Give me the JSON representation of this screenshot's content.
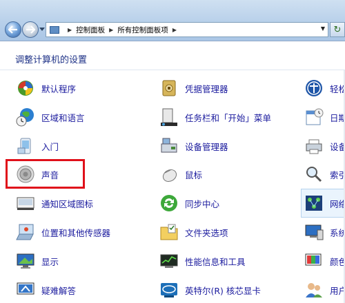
{
  "address_bar": {
    "breadcrumb": [
      "控制面板",
      "所有控制面板项"
    ]
  },
  "page": {
    "title": "调整计算机的设置"
  },
  "items": {
    "col1": [
      "默认程序",
      "区域和语言",
      "入门",
      "声音",
      "通知区域图标",
      "位置和其他传感器",
      "显示",
      "疑难解答"
    ],
    "col2": [
      "凭据管理器",
      "任务栏和「开始」菜单",
      "设备管理器",
      "鼠标",
      "同步中心",
      "文件夹选项",
      "性能信息和工具",
      "英特尔(R) 核芯显卡"
    ],
    "col3": [
      "轻松",
      "日期",
      "设备",
      "索引",
      "网络",
      "系统",
      "颜色",
      "用户"
    ]
  },
  "icons": {
    "col1": [
      "default-programs-icon",
      "globe-clock-icon",
      "getting-started-icon",
      "speaker-icon",
      "notification-area-icon",
      "sensor-icon",
      "monitor-icon",
      "troubleshoot-icon"
    ],
    "col2": [
      "credential-vault-icon",
      "taskbar-icon",
      "device-manager-icon",
      "mouse-icon",
      "sync-center-icon",
      "folder-options-icon",
      "performance-icon",
      "intel-graphics-icon"
    ],
    "col3": [
      "ease-of-access-icon",
      "calendar-icon",
      "devices-printers-icon",
      "indexing-icon",
      "network-icon",
      "system-icon",
      "color-management-icon",
      "user-accounts-icon"
    ]
  },
  "colors": {
    "link": "#1b1b9e",
    "title": "#1e3287",
    "highlight": "#e0101a"
  }
}
